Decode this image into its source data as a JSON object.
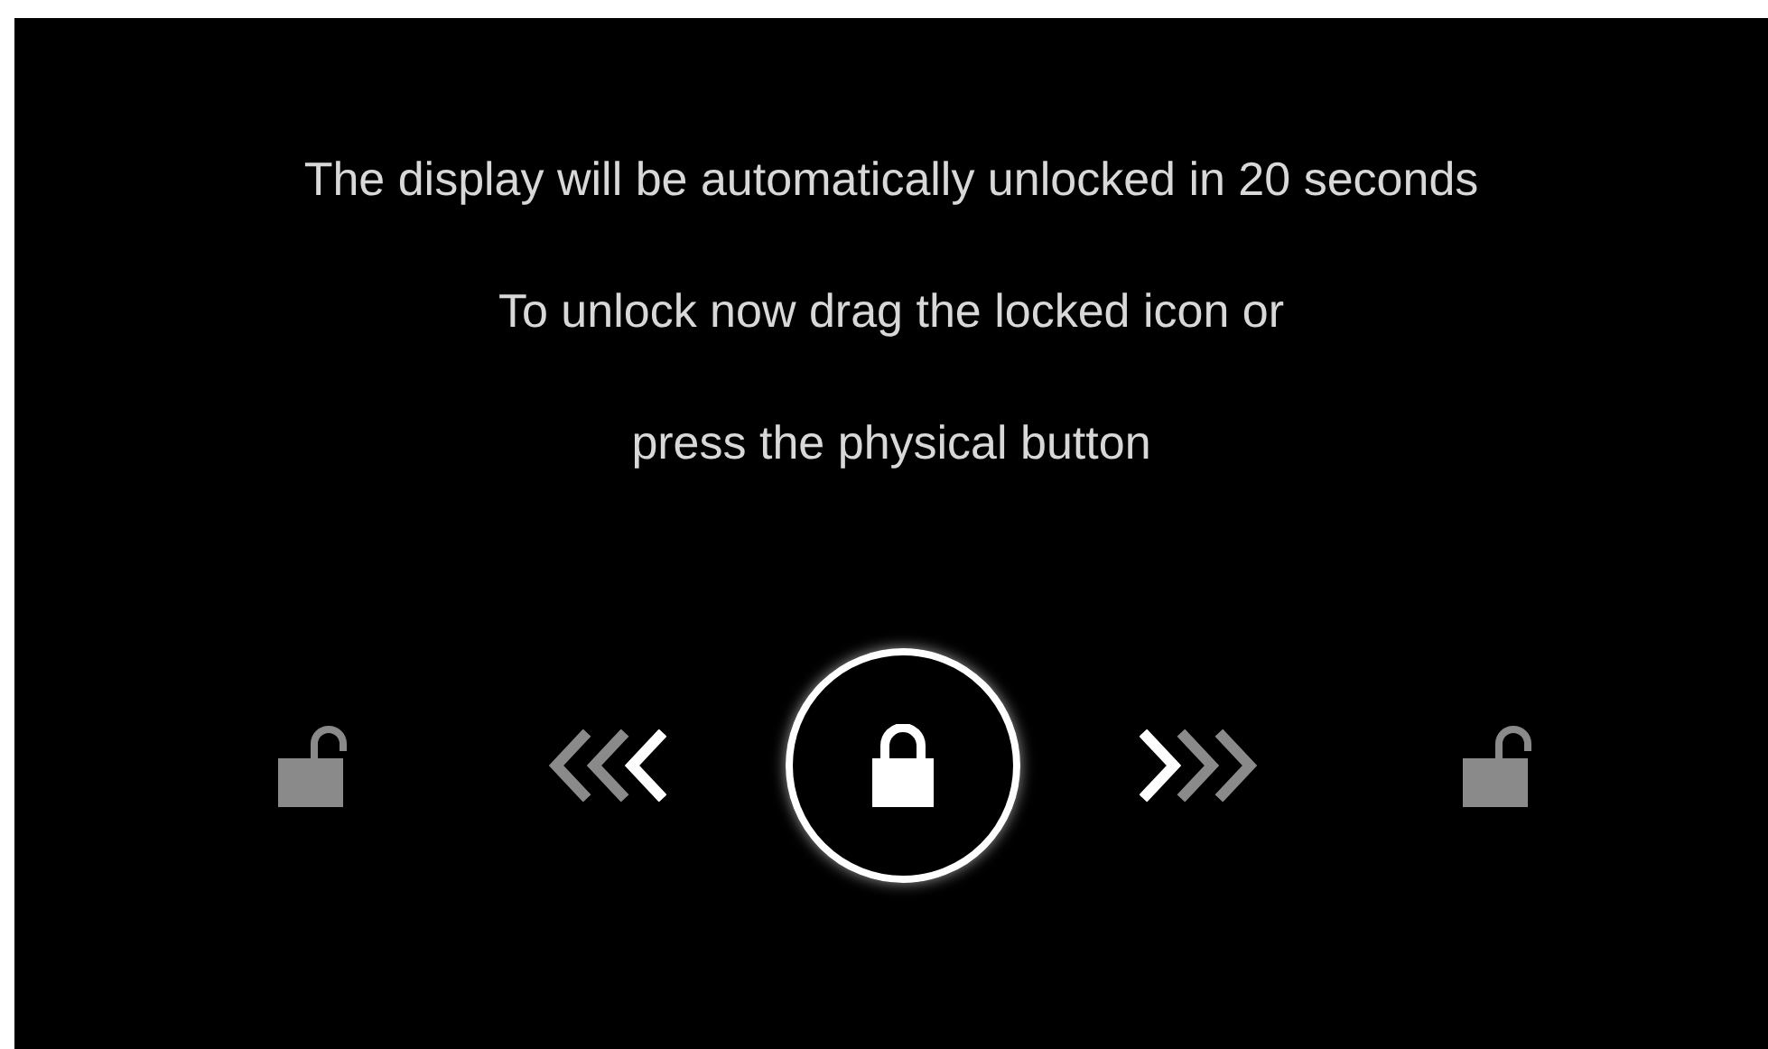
{
  "messages": [
    {
      "text": "The display will be automatically unlocked in 20 seconds"
    },
    {
      "text": "To unlock now drag the locked icon or"
    },
    {
      "text": "press the physical button"
    }
  ]
}
